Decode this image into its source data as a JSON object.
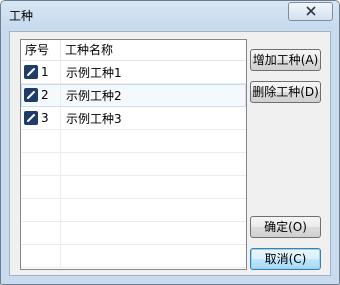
{
  "window": {
    "title": "工种"
  },
  "list": {
    "columns": [
      "序号",
      "工种名称"
    ],
    "rows": [
      {
        "index": "1",
        "name": "示例工种1",
        "checked": true,
        "selected": false
      },
      {
        "index": "2",
        "name": "示例工种2",
        "checked": true,
        "selected": true
      },
      {
        "index": "3",
        "name": "示例工种3",
        "checked": true,
        "selected": false
      }
    ]
  },
  "buttons": {
    "add": "增加工种(A)",
    "delete": "删除工种(D)",
    "ok": "确定(O)",
    "cancel": "取消(C)"
  },
  "icons": {
    "close": "close-icon",
    "checkbox": "check-icon"
  }
}
